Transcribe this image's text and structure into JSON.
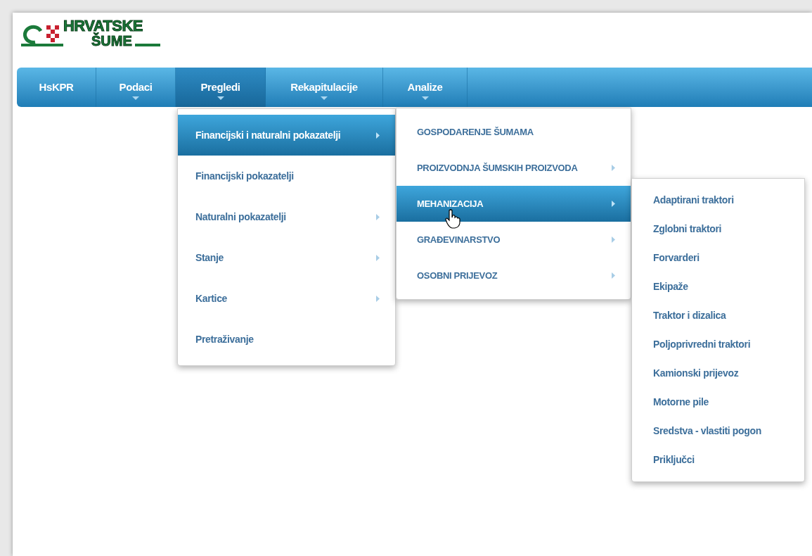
{
  "logo": {
    "line1": "HRVATSKE",
    "line2": "ŠUME"
  },
  "nav": [
    {
      "label": "HsKPR",
      "selected": false,
      "has_dropdown": false
    },
    {
      "label": "Podaci",
      "selected": false,
      "has_dropdown": true
    },
    {
      "label": "Pregledi",
      "selected": true,
      "has_dropdown": true
    },
    {
      "label": "Rekapitulacije",
      "selected": false,
      "has_dropdown": true
    },
    {
      "label": "Analize",
      "selected": false,
      "has_dropdown": true
    }
  ],
  "menus": [
    {
      "items": [
        {
          "label": "Financijski i naturalni pokazatelji",
          "selected": true,
          "has_submenu": true
        },
        {
          "label": "Financijski pokazatelji",
          "selected": false,
          "has_submenu": false
        },
        {
          "label": "Naturalni pokazatelji",
          "selected": false,
          "has_submenu": true
        },
        {
          "label": "Stanje",
          "selected": false,
          "has_submenu": true
        },
        {
          "label": "Kartice",
          "selected": false,
          "has_submenu": true
        },
        {
          "label": "Pretraživanje",
          "selected": false,
          "has_submenu": false
        }
      ]
    },
    {
      "items": [
        {
          "label": "GOSPODARENJE ŠUMAMA",
          "selected": false,
          "has_submenu": false
        },
        {
          "label": "PROIZVODNJA ŠUMSKIH PROIZVODA",
          "selected": false,
          "has_submenu": true
        },
        {
          "label": "MEHANIZACIJA",
          "selected": true,
          "has_submenu": true
        },
        {
          "label": "GRAĐEVINARSTVO",
          "selected": false,
          "has_submenu": true
        },
        {
          "label": "OSOBNI PRIJEVOZ",
          "selected": false,
          "has_submenu": true
        }
      ]
    },
    {
      "items": [
        {
          "label": "Adaptirani traktori",
          "selected": false,
          "has_submenu": false
        },
        {
          "label": "Zglobni traktori",
          "selected": false,
          "has_submenu": false
        },
        {
          "label": "Forvarderi",
          "selected": false,
          "has_submenu": false
        },
        {
          "label": "Ekipaže",
          "selected": false,
          "has_submenu": false
        },
        {
          "label": "Traktor i dizalica",
          "selected": false,
          "has_submenu": false
        },
        {
          "label": "Poljoprivredni traktori",
          "selected": false,
          "has_submenu": false
        },
        {
          "label": "Kamionski prijevoz",
          "selected": false,
          "has_submenu": false
        },
        {
          "label": "Motorne pile",
          "selected": false,
          "has_submenu": false
        },
        {
          "label": "Sredstva - vlastiti pogon",
          "selected": false,
          "has_submenu": false
        },
        {
          "label": "Priključci",
          "selected": false,
          "has_submenu": false
        }
      ]
    }
  ]
}
